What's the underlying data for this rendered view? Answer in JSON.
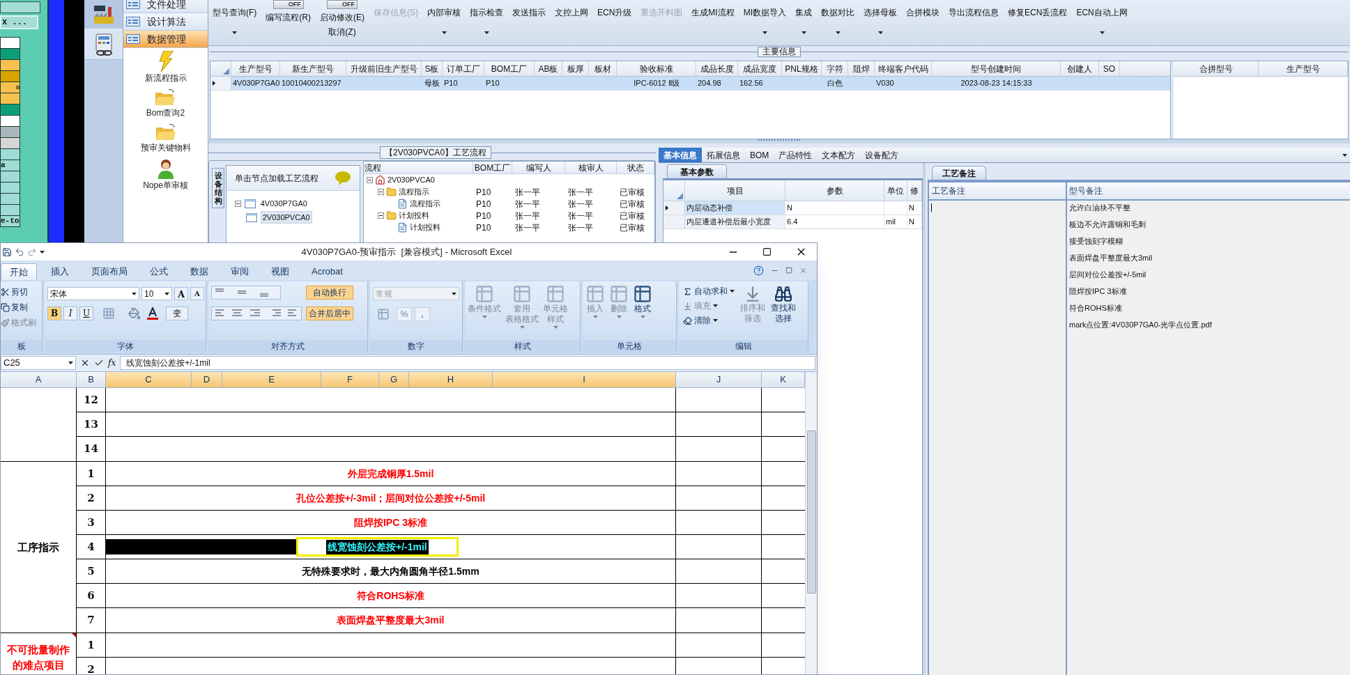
{
  "left_panel": {
    "button": "x ...",
    "cells": [
      {
        "color": "#ffffff"
      },
      {
        "color": "#0e9f77"
      },
      {
        "color": "#f7c14d"
      },
      {
        "color": "#d8a200"
      },
      {
        "color": "#f7c14d",
        "expander": "⊞"
      },
      {
        "color": "#f7c14d"
      },
      {
        "color": "#0e9f77"
      },
      {
        "color": "#ffffff"
      },
      {
        "color": "#a9b9bb"
      },
      {
        "color": "#d6d6d6"
      },
      {
        "color": "#9fdcd6"
      },
      {
        "color": "#9fdcd6",
        "label": "a"
      },
      {
        "color": "#9fdcd6"
      },
      {
        "color": "#9fdcd6"
      },
      {
        "color": "#9fdcd6"
      },
      {
        "color": "#9fdcd6"
      },
      {
        "color": "#9fdcd6",
        "label": "e-to"
      }
    ]
  },
  "nav_menu": {
    "categories": [
      {
        "label": "文件处理",
        "selected": false
      },
      {
        "label": "设计算法",
        "selected": false
      },
      {
        "label": "数据管理",
        "selected": true
      }
    ],
    "items": [
      {
        "label": "新流程指示",
        "kind": "bolt"
      },
      {
        "label": "Bom查询2",
        "kind": "folder"
      },
      {
        "label": "预审关键物料",
        "kind": "folder"
      },
      {
        "label": "Nope单审核",
        "kind": "person"
      }
    ]
  },
  "toolbar": [
    {
      "kind": "button",
      "label": "型号查询(F)",
      "dropdown": true,
      "disabled": false
    },
    {
      "kind": "toggle",
      "switch": "OFF",
      "on": false,
      "label": "编写流程(R)"
    },
    {
      "kind": "toggle",
      "switch": "OFF",
      "on": false,
      "label": "启动修改(E)",
      "sublabel": "取消(Z)"
    },
    {
      "kind": "button",
      "label": "保存信息(S)",
      "dropdown": false,
      "disabled": true
    },
    {
      "kind": "button",
      "label": "内部审核",
      "dropdown": true,
      "disabled": false
    },
    {
      "kind": "button",
      "label": "指示检查",
      "dropdown": true,
      "disabled": false
    },
    {
      "kind": "button",
      "label": "发送指示",
      "dropdown": false,
      "disabled": false
    },
    {
      "kind": "button",
      "label": "文控上网",
      "dropdown": false,
      "disabled": false
    },
    {
      "kind": "button",
      "label": "ECN升级",
      "dropdown": false,
      "disabled": false
    },
    {
      "kind": "button",
      "label": "重选开料图",
      "dropdown": false,
      "disabled": true
    },
    {
      "kind": "button",
      "label": "生成MI流程",
      "dropdown": false,
      "disabled": false
    },
    {
      "kind": "button",
      "label": "MI数据导入",
      "dropdown": true,
      "disabled": false
    },
    {
      "kind": "button",
      "label": "集成",
      "dropdown": true,
      "disabled": false
    },
    {
      "kind": "button",
      "label": "数据对比",
      "dropdown": true,
      "disabled": false
    },
    {
      "kind": "button",
      "label": "选择母板",
      "dropdown": true,
      "disabled": false
    },
    {
      "kind": "button",
      "label": "合拼模块",
      "dropdown": false,
      "disabled": false
    },
    {
      "kind": "button",
      "label": "导出流程信息",
      "dropdown": false,
      "disabled": false
    },
    {
      "kind": "button",
      "label": "修复ECN丢流程",
      "dropdown": false,
      "disabled": false
    },
    {
      "kind": "button",
      "label": "ECN自动上网",
      "dropdown": true,
      "disabled": false
    }
  ],
  "main_info": {
    "title": "主要信息",
    "columns": [
      "生产型号",
      "新生产型号",
      "升级前旧生产型号",
      "S板",
      "订单工厂",
      "BOM工厂",
      "AB板",
      "板厚",
      "板材",
      "验收标准",
      "成品长度",
      "成品宽度",
      "PNL规格",
      "字符",
      "阻焊",
      "终端客户代码",
      "型号创建时间",
      "创建人",
      "SO"
    ],
    "rows": [
      {
        "selected": true,
        "cells": [
          "4V030P7GA0",
          "10010400213297",
          null,
          "母板",
          "P10",
          "P10",
          null,
          null,
          null,
          "IPC-6012 Ⅱ级",
          "204.98",
          "162.56",
          null,
          "白色",
          null,
          "V030",
          "2023-08-23 14:15:33",
          null,
          null
        ]
      }
    ],
    "merge_columns": [
      "合拼型号",
      "生产型号"
    ]
  },
  "process": {
    "title": "【2V030PVCA0】工艺流程",
    "side_tab": "设备结构",
    "tree_header": "单击节点加载工艺流程",
    "tree": [
      {
        "label": "4V030P7GA0",
        "expanded": true,
        "selected": false,
        "children": [
          {
            "label": "2V030PVCA0",
            "selected": true
          }
        ]
      }
    ],
    "columns": [
      "流程",
      "BOM工厂",
      "编写人",
      "核审人",
      "状态"
    ],
    "rows": [
      {
        "label": "2V030PVCA0",
        "kind": "home",
        "expanded": true,
        "children": [
          {
            "label": "流程指示",
            "kind": "folder",
            "expanded": true,
            "cells": [
              "P10",
              "张一平",
              "张一平",
              "已审核"
            ],
            "children": [
              {
                "label": "流程指示",
                "kind": "file",
                "cells": [
                  "P10",
                  "张一平",
                  "张一平",
                  "已审核"
                ]
              }
            ]
          },
          {
            "label": "计划投料",
            "kind": "folder",
            "expanded": true,
            "cells": [
              "P10",
              "张一平",
              "张一平",
              "已审核"
            ],
            "children": [
              {
                "label": "计划投料",
                "kind": "file",
                "cells": [
                  "P10",
                  "张一平",
                  "张一平",
                  "已审核"
                ]
              }
            ]
          }
        ]
      }
    ]
  },
  "info_tabs": [
    {
      "label": "基本信息",
      "selected": true
    },
    {
      "label": "拓展信息",
      "selected": false
    },
    {
      "label": "BOM",
      "selected": false
    },
    {
      "label": "产品特性",
      "selected": false
    },
    {
      "label": "文本配方",
      "selected": false
    },
    {
      "label": "设备配方",
      "selected": false
    }
  ],
  "basic": {
    "tab": "基本参数",
    "columns": [
      "项目",
      "参数",
      "单位",
      "修"
    ],
    "rows": [
      {
        "current": true,
        "cells": [
          "内层动态补偿",
          "N",
          null,
          "N"
        ]
      },
      {
        "current": false,
        "cells": [
          "内层通道补偿后最小宽度",
          "6.4",
          "mil",
          "N"
        ]
      }
    ]
  },
  "remarks": {
    "tab": "工艺备注",
    "columns": [
      "工艺备注",
      "型号备注"
    ],
    "model_notes": [
      "允许白油块不平整",
      "板边不允许露铜和毛刺",
      "接受蚀刻字模糊",
      "表面焊盘平整度最大3mil",
      "层间对位公差按+/-5mil",
      "阻焊按IPC 3标准",
      "符合ROHS标准",
      "mark点位置:4V030P7GA0-光学点位置.pdf"
    ]
  },
  "excel": {
    "title": "4V030P7GA0-预审指示  [兼容模式] - Microsoft Excel",
    "tabs": [
      {
        "label": "开始",
        "selected": true
      },
      {
        "label": "插入",
        "selected": false
      },
      {
        "label": "页面布局",
        "selected": false
      },
      {
        "label": "公式",
        "selected": false
      },
      {
        "label": "数据",
        "selected": false
      },
      {
        "label": "审阅",
        "selected": false
      },
      {
        "label": "视图",
        "selected": false
      },
      {
        "label": "Acrobat",
        "selected": false
      }
    ],
    "ribbon": [
      {
        "kind": "clipboard",
        "label": "板",
        "items": [
          {
            "label": "剪切",
            "disabled": false
          },
          {
            "label": "复制",
            "disabled": false
          },
          {
            "label": "格式刷",
            "disabled": true
          }
        ]
      },
      {
        "kind": "font",
        "label": "字体",
        "font": "宋体",
        "size": "10",
        "grow": "A",
        "shrink": "A",
        "styles": [
          "B",
          "I",
          "U"
        ],
        "phonetic": "变"
      },
      {
        "kind": "alignment",
        "label": "对齐方式",
        "wrap": "自动换行",
        "merge": "合并后居中"
      },
      {
        "kind": "number",
        "label": "数字",
        "format": "常规",
        "percent": "%",
        "comma": ","
      },
      {
        "kind": "large",
        "label": "样式",
        "items": [
          {
            "lines": [
              "条件格式"
            ],
            "disabled": true
          },
          {
            "lines": [
              "套用",
              "表格格式"
            ],
            "disabled": true
          },
          {
            "lines": [
              "单元格",
              "样式"
            ],
            "disabled": true
          }
        ]
      },
      {
        "kind": "large",
        "label": "单元格",
        "items": [
          {
            "lines": [
              "插入"
            ],
            "disabled": true
          },
          {
            "lines": [
              "删除"
            ],
            "disabled": true
          },
          {
            "lines": [
              "格式"
            ],
            "disabled": false
          }
        ]
      },
      {
        "kind": "editing",
        "label": "编辑",
        "small": [
          {
            "label": "自动求和",
            "disabled": false
          },
          {
            "label": "填充",
            "disabled": true
          },
          {
            "label": "清除",
            "disabled": false
          }
        ],
        "large": [
          {
            "lines": [
              "排序和",
              "筛选"
            ],
            "disabled": true
          },
          {
            "lines": [
              "查找和",
              "选择"
            ],
            "disabled": false
          }
        ]
      }
    ],
    "name_box": "C25",
    "function_label": "fx",
    "formula": "线宽蚀刻公差按+/-1mil",
    "columns": [
      {
        "label": "A",
        "selected": false
      },
      {
        "label": "B",
        "selected": false
      },
      {
        "label": "C",
        "selected": true
      },
      {
        "label": "D",
        "selected": true
      },
      {
        "label": "E",
        "selected": true
      },
      {
        "label": "F",
        "selected": true
      },
      {
        "label": "G",
        "selected": true
      },
      {
        "label": "H",
        "selected": true
      },
      {
        "label": "I",
        "selected": true
      },
      {
        "label": "J",
        "selected": false
      },
      {
        "label": "K",
        "selected": false
      }
    ],
    "sections": [
      {
        "rows": [
          {
            "number": "12"
          },
          {
            "number": "13"
          },
          {
            "number": "14"
          }
        ]
      },
      {
        "title": [
          "工序指示"
        ],
        "color": "#000000",
        "comment": false,
        "rows": [
          {
            "number": "1",
            "text": "外层完成铜厚1.5mil",
            "color": "#ff0000",
            "selected": false
          },
          {
            "number": "2",
            "text": "孔位公差按+/-3mil；层间对位公差按+/-5mil",
            "color": "#ff0000",
            "selected": false
          },
          {
            "number": "3",
            "text": "阻焊按IPC 3标准",
            "color": "#ff0000",
            "selected": false
          },
          {
            "number": "4",
            "text": "线宽蚀刻公差按+/-1mil",
            "selected": true
          },
          {
            "number": "5",
            "text": "无特殊要求时，最大内角圆角半径1.5mm",
            "color": "#000000",
            "selected": false
          },
          {
            "number": "6",
            "text": "符合ROHS标准",
            "color": "#ff0000",
            "selected": false
          },
          {
            "number": "7",
            "text": "表面焊盘平整度最大3mil",
            "color": "#ff0000",
            "selected": false
          }
        ]
      },
      {
        "title": [
          "不可批量制作",
          "的难点项目"
        ],
        "color": "#ff0000",
        "comment": true,
        "rows": [
          {
            "number": "1"
          },
          {
            "number": "2"
          }
        ]
      }
    ]
  }
}
